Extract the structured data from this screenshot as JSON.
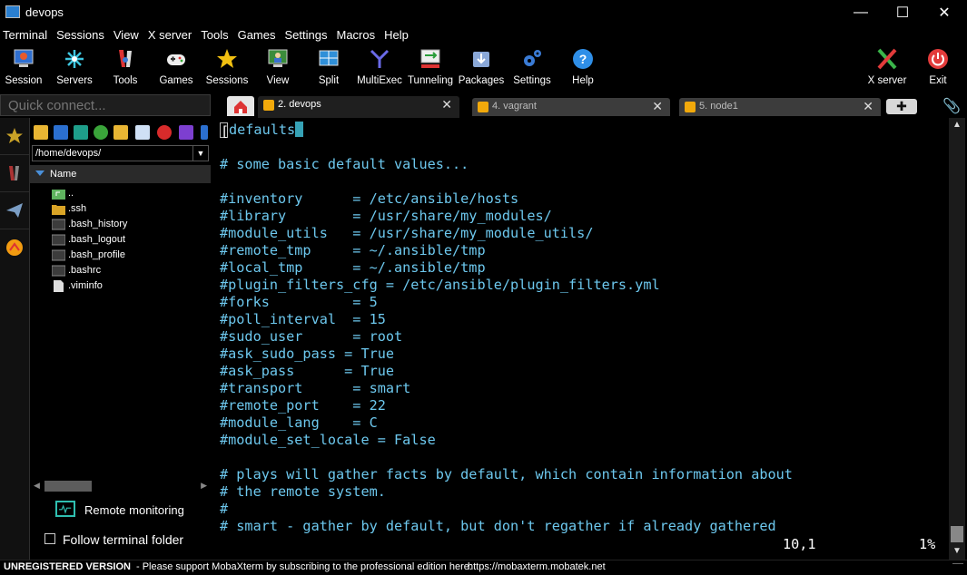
{
  "window": {
    "title": "devops"
  },
  "menu": [
    "Terminal",
    "Sessions",
    "View",
    "X server",
    "Tools",
    "Games",
    "Settings",
    "Macros",
    "Help"
  ],
  "toolbar": {
    "session": "Session",
    "servers": "Servers",
    "tools": "Tools",
    "games": "Games",
    "sessions": "Sessions",
    "view": "View",
    "split": "Split",
    "multiexec": "MultiExec",
    "tunneling": "Tunneling",
    "packages": "Packages",
    "settings": "Settings",
    "help": "Help",
    "xserver": "X server",
    "exit": "Exit"
  },
  "quick_connect": {
    "placeholder": "Quick connect..."
  },
  "tabs": [
    {
      "label": "2. devops",
      "active": true
    },
    {
      "label": "4. vagrant",
      "active": false
    },
    {
      "label": "5. node1",
      "active": false
    }
  ],
  "sidebar": {
    "path": "/home/devops/",
    "column_header": "Name",
    "files": [
      {
        "name": "..",
        "icon": "parent-folder-icon"
      },
      {
        "name": ".ssh",
        "icon": "folder-icon"
      },
      {
        "name": ".bash_history",
        "icon": "file-icon"
      },
      {
        "name": ".bash_logout",
        "icon": "file-icon"
      },
      {
        "name": ".bash_profile",
        "icon": "file-icon"
      },
      {
        "name": ".bashrc",
        "icon": "file-icon"
      },
      {
        "name": ".viminfo",
        "icon": "file-icon"
      }
    ],
    "remote_monitoring": "Remote monitoring",
    "follow_terminal_folder": "Follow terminal folder",
    "follow_checked": false
  },
  "terminal": {
    "first_line_rest": "defaults",
    "lines": [
      "",
      "# some basic default values...",
      "",
      "#inventory      = /etc/ansible/hosts",
      "#library        = /usr/share/my_modules/",
      "#module_utils   = /usr/share/my_module_utils/",
      "#remote_tmp     = ~/.ansible/tmp",
      "#local_tmp      = ~/.ansible/tmp",
      "#plugin_filters_cfg = /etc/ansible/plugin_filters.yml",
      "#forks          = 5",
      "#poll_interval  = 15",
      "#sudo_user      = root",
      "#ask_sudo_pass = True",
      "#ask_pass      = True",
      "#transport      = smart",
      "#remote_port    = 22",
      "#module_lang    = C",
      "#module_set_locale = False",
      "",
      "# plays will gather facts by default, which contain information about",
      "# the remote system.",
      "#",
      "# smart - gather by default, but don't regather if already gathered"
    ],
    "cursor_pos": "10,1",
    "scroll_percent": "1%"
  },
  "statusbar": {
    "unregistered": "UNREGISTERED VERSION",
    "message": " -  Please support MobaXterm by subscribing to the professional edition here:",
    "url": "https://mobaxterm.mobatek.net"
  },
  "colors": {
    "terminal_text": "#6dc8ee",
    "cursor": "#36a2b6",
    "tab_active_bg": "#1f1f1f"
  }
}
